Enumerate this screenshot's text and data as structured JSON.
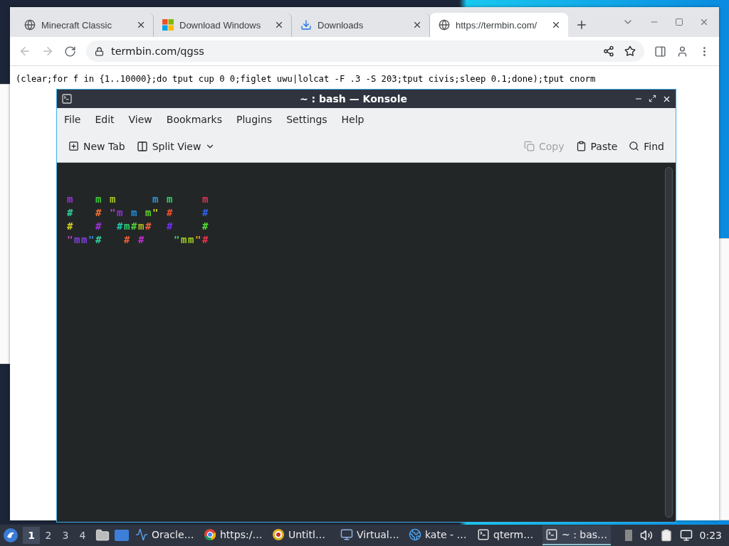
{
  "browser": {
    "tabs": [
      {
        "label": "Minecraft Classic",
        "selected": false
      },
      {
        "label": "Download Windows",
        "selected": false
      },
      {
        "label": "Downloads",
        "selected": false
      },
      {
        "label": "https://termbin.com/",
        "selected": true
      }
    ],
    "address": "termbin.com/qgss",
    "page_text": "(clear;for f in {1..10000};do tput cup 0 0;figlet uwu|lolcat -F .3 -S 203;tput civis;sleep 0.1;done);tput cnorm"
  },
  "konsole": {
    "title": "~ : bash — Konsole",
    "menu": [
      "File",
      "Edit",
      "View",
      "Bookmarks",
      "Plugins",
      "Settings",
      "Help"
    ],
    "toolbar_left": [
      {
        "label": "New Tab",
        "disabled": false
      },
      {
        "label": "Split View",
        "disabled": false
      }
    ],
    "toolbar_right": [
      {
        "label": "Copy",
        "disabled": true
      },
      {
        "label": "Paste",
        "disabled": false
      },
      {
        "label": "Find",
        "disabled": false
      }
    ],
    "terminal": {
      "lines": [
        [
          {
            "text": "m",
            "color": "#9b35d6"
          },
          {
            "text": "   m",
            "color": "#3ec83e"
          },
          {
            "text": " m",
            "color": "#a8c820"
          },
          {
            "text": "     m",
            "color": "#2a9ad8"
          },
          {
            "text": " m",
            "color": "#30d060"
          },
          {
            "text": "    m",
            "color": "#e0305a"
          }
        ],
        [
          {
            "text": "#",
            "color": "#30d0a0"
          },
          {
            "text": "   #",
            "color": "#f07030"
          },
          {
            "text": " \"",
            "color": "#c040c0"
          },
          {
            "text": "m",
            "color": "#9030e0"
          },
          {
            "text": " m",
            "color": "#2090e0"
          },
          {
            "text": " m",
            "color": "#60d030"
          },
          {
            "text": "\"",
            "color": "#c8d020"
          },
          {
            "text": " #",
            "color": "#f05030"
          },
          {
            "text": "    #",
            "color": "#3060f0"
          }
        ],
        [
          {
            "text": "#",
            "color": "#d0d020"
          },
          {
            "text": "   #",
            "color": "#a030e0"
          },
          {
            "text": "  #",
            "color": "#20c8b0"
          },
          {
            "text": "m",
            "color": "#30d070"
          },
          {
            "text": "#",
            "color": "#50d040"
          },
          {
            "text": "m",
            "color": "#b0c020"
          },
          {
            "text": "#",
            "color": "#f06030"
          },
          {
            "text": "  #",
            "color": "#7030f0"
          },
          {
            "text": "    #",
            "color": "#50e030"
          }
        ],
        [
          {
            "text": "\"",
            "color": "#c040c0"
          },
          {
            "text": "mm",
            "color": "#8040e0"
          },
          {
            "text": "\"",
            "color": "#3090e0"
          },
          {
            "text": "#",
            "color": "#30d0a0"
          },
          {
            "text": "   #",
            "color": "#f06030"
          },
          {
            "text": " #",
            "color": "#c030d0"
          },
          {
            "text": "    \"",
            "color": "#40d060"
          },
          {
            "text": "mm",
            "color": "#a0d020"
          },
          {
            "text": "\"",
            "color": "#e0a020"
          },
          {
            "text": "#",
            "color": "#f03050"
          }
        ]
      ]
    }
  },
  "taskbar": {
    "workspaces": [
      {
        "label": "1",
        "selected": true
      },
      {
        "label": "2",
        "selected": false
      },
      {
        "label": "3",
        "selected": false
      },
      {
        "label": "4",
        "selected": false
      }
    ],
    "tasks": [
      {
        "label": "Oracle…",
        "selected": false
      },
      {
        "label": "https:/…",
        "selected": false
      },
      {
        "label": "Untitl…",
        "selected": false
      },
      {
        "label": "Virtual…",
        "selected": false
      },
      {
        "label": "kate - …",
        "selected": false
      },
      {
        "label": "qterm…",
        "selected": false
      },
      {
        "label": "~ : bas…",
        "selected": true
      }
    ],
    "clock": "0:23"
  }
}
